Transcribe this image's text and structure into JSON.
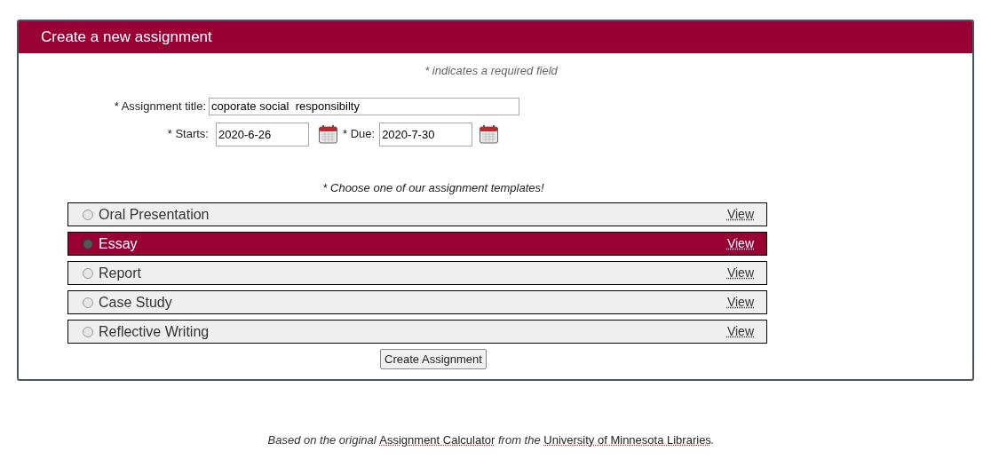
{
  "header": {
    "title": "Create a new assignment"
  },
  "required_note": "* indicates a required field",
  "fields": [
    {
      "label": "* Assignment title:",
      "value": "coporate social  responsibilty"
    }
  ],
  "dates": [
    {
      "label": "* Starts:",
      "value": "2020-6-26"
    },
    {
      "label": "* Due:",
      "value": "2020-7-30"
    }
  ],
  "templates_prompt": "* Choose one of our assignment templates!",
  "templates": [
    {
      "name": "Oral Presentation",
      "link": "View",
      "selected": false
    },
    {
      "name": "Essay",
      "link": "View",
      "selected": true
    },
    {
      "name": "Report",
      "link": "View",
      "selected": false
    },
    {
      "name": "Case Study",
      "link": "View",
      "selected": false
    },
    {
      "name": "Reflective Writing",
      "link": "View",
      "selected": false
    }
  ],
  "submit": "Create Assignment",
  "footer": {
    "prefix": "Based on the original",
    "link1": "Assignment Calculator",
    "middle": "from the",
    "link2": "University of Minnesota Libraries",
    "suffix": "."
  }
}
